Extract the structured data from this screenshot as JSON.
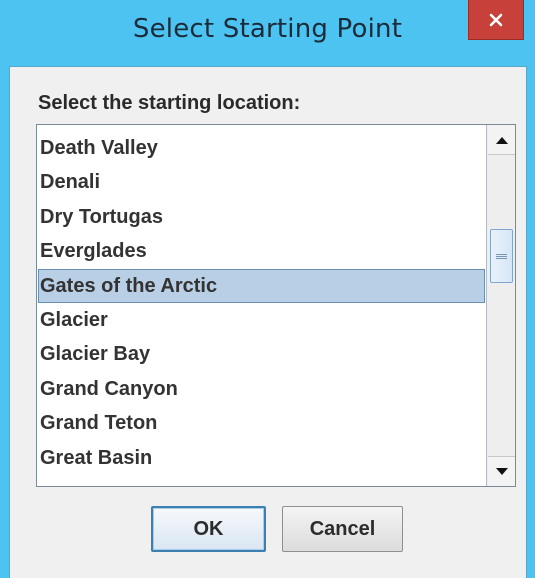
{
  "window": {
    "title": "Select Starting Point",
    "colors": {
      "frame": "#4cc3f0",
      "close_button": "#c7403a",
      "selection": "#b8cfe5",
      "client": "#f0f0f0"
    },
    "icons": {
      "close": "close-x-icon",
      "scroll_up": "arrow-up-icon",
      "scroll_down": "arrow-down-icon",
      "scroll_grip": "grip-lines-icon"
    }
  },
  "dialog": {
    "prompt": "Select the starting location:",
    "locations": [
      "Death Valley",
      "Denali",
      "Dry Tortugas",
      "Everglades",
      "Gates of the Arctic",
      "Glacier",
      "Glacier Bay",
      "Grand Canyon",
      "Grand Teton",
      "Great Basin"
    ],
    "selected_location": "Gates of the Arctic",
    "scroll": {
      "position": 0.3,
      "visible_fraction": 0.18
    },
    "ok_label": "OK",
    "cancel_label": "Cancel"
  }
}
